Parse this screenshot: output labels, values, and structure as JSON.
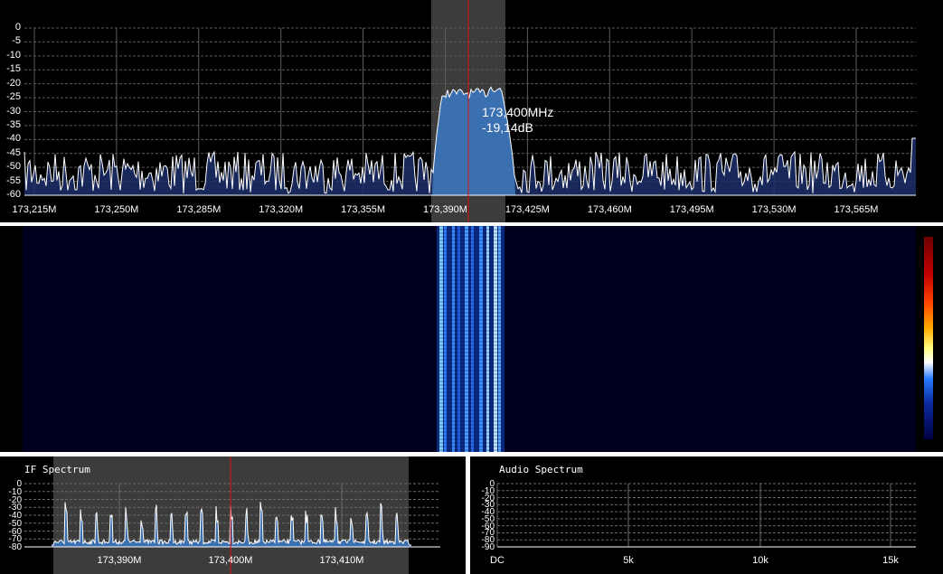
{
  "main_spectrum": {
    "y_ticks": [
      "0",
      "-5",
      "-10",
      "-15",
      "-20",
      "-25",
      "-30",
      "-35",
      "-40",
      "-45",
      "-50",
      "-55",
      "-60"
    ],
    "x_ticks": [
      "173,215M",
      "173,250M",
      "173,285M",
      "173,320M",
      "173,355M",
      "173,390M",
      "173,425M",
      "173,460M",
      "173,495M",
      "173,530M",
      "173,565M"
    ],
    "cursor_frequency": "173,400MHz",
    "cursor_level": "-19,14dB"
  },
  "waterfall": {
    "colorbar_colors": [
      "#6e0000",
      "#c00000",
      "#ff4000",
      "#ffaa00",
      "#ffff80",
      "#ffffff",
      "#2a7bff",
      "#0a2aa0",
      "#000040"
    ]
  },
  "if_spectrum": {
    "title": "IF Spectrum",
    "y_ticks": [
      "0",
      "-10",
      "-20",
      "-30",
      "-40",
      "-50",
      "-60",
      "-70",
      "-80"
    ],
    "x_ticks": [
      "173,390M",
      "173,400M",
      "173,410M"
    ]
  },
  "audio_spectrum": {
    "title": "Audio Spectrum",
    "y_ticks": [
      "0",
      "-10",
      "-20",
      "-30",
      "-40",
      "-50",
      "-60",
      "-70",
      "-80",
      "-90"
    ],
    "x_ticks": [
      "DC",
      "5k",
      "10k",
      "15k"
    ]
  },
  "colors": {
    "background": "#000000",
    "trace": "#ffffff",
    "fill": "#3a6fb0",
    "passband": "#3c3c3c",
    "cursor": "#e01010",
    "waterfall_bg": "#00001e"
  }
}
